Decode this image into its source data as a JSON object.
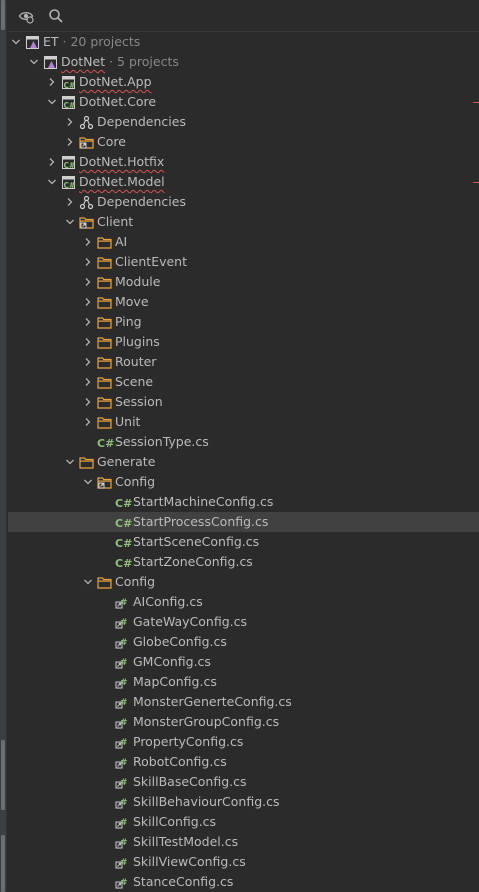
{
  "colors": {
    "background": "#2b2b2b",
    "selection": "#414141",
    "folder": "#e8a33d",
    "csharp": "#8fbf7a",
    "error_underline": "#d25252"
  },
  "toolbar": {
    "icons": [
      "eye-filter-icon",
      "search-icon"
    ]
  },
  "tree": [
    {
      "indent": 0,
      "expanded": true,
      "kind": "solution",
      "label": "ET",
      "meta": " · 20 projects"
    },
    {
      "indent": 1,
      "expanded": true,
      "kind": "solution",
      "label": "DotNet",
      "meta": " · 5 projects",
      "squiggle": true
    },
    {
      "indent": 2,
      "expanded": false,
      "kind": "project",
      "label": "DotNet.App",
      "squiggle": true
    },
    {
      "indent": 2,
      "expanded": true,
      "kind": "project",
      "label": "DotNet.Core"
    },
    {
      "indent": 3,
      "expanded": false,
      "kind": "deps",
      "label": "Dependencies"
    },
    {
      "indent": 3,
      "expanded": false,
      "kind": "linkfolder",
      "label": "Core"
    },
    {
      "indent": 2,
      "expanded": false,
      "kind": "project",
      "label": "DotNet.Hotfix",
      "squiggle": true
    },
    {
      "indent": 2,
      "expanded": true,
      "kind": "project",
      "label": "DotNet.Model",
      "squiggle": true
    },
    {
      "indent": 3,
      "expanded": false,
      "kind": "deps",
      "label": "Dependencies"
    },
    {
      "indent": 3,
      "expanded": true,
      "kind": "linkfolder",
      "label": "Client"
    },
    {
      "indent": 4,
      "expanded": false,
      "kind": "folder",
      "label": "AI"
    },
    {
      "indent": 4,
      "expanded": false,
      "kind": "folder",
      "label": "ClientEvent"
    },
    {
      "indent": 4,
      "expanded": false,
      "kind": "folder",
      "label": "Module"
    },
    {
      "indent": 4,
      "expanded": false,
      "kind": "folder",
      "label": "Move"
    },
    {
      "indent": 4,
      "expanded": false,
      "kind": "folder",
      "label": "Ping"
    },
    {
      "indent": 4,
      "expanded": false,
      "kind": "folder",
      "label": "Plugins"
    },
    {
      "indent": 4,
      "expanded": false,
      "kind": "folder",
      "label": "Router"
    },
    {
      "indent": 4,
      "expanded": false,
      "kind": "folder",
      "label": "Scene"
    },
    {
      "indent": 4,
      "expanded": false,
      "kind": "folder",
      "label": "Session"
    },
    {
      "indent": 4,
      "expanded": false,
      "kind": "folder",
      "label": "Unit"
    },
    {
      "indent": 4,
      "kind": "cs",
      "label": "SessionType.cs"
    },
    {
      "indent": 3,
      "expanded": true,
      "kind": "folder",
      "label": "Generate"
    },
    {
      "indent": 4,
      "expanded": true,
      "kind": "linkfolder",
      "label": "Config"
    },
    {
      "indent": 5,
      "kind": "cs",
      "label": "StartMachineConfig.cs"
    },
    {
      "indent": 5,
      "kind": "cs",
      "label": "StartProcessConfig.cs",
      "selected": true
    },
    {
      "indent": 5,
      "kind": "cs",
      "label": "StartSceneConfig.cs"
    },
    {
      "indent": 5,
      "kind": "cs",
      "label": "StartZoneConfig.cs"
    },
    {
      "indent": 4,
      "expanded": true,
      "kind": "folder",
      "label": "Config"
    },
    {
      "indent": 5,
      "kind": "cslink",
      "label": "AIConfig.cs"
    },
    {
      "indent": 5,
      "kind": "cslink",
      "label": "GateWayConfig.cs"
    },
    {
      "indent": 5,
      "kind": "cslink",
      "label": "GlobeConfig.cs"
    },
    {
      "indent": 5,
      "kind": "cslink",
      "label": "GMConfig.cs"
    },
    {
      "indent": 5,
      "kind": "cslink",
      "label": "MapConfig.cs"
    },
    {
      "indent": 5,
      "kind": "cslink",
      "label": "MonsterGenerteConfig.cs"
    },
    {
      "indent": 5,
      "kind": "cslink",
      "label": "MonsterGroupConfig.cs"
    },
    {
      "indent": 5,
      "kind": "cslink",
      "label": "PropertyConfig.cs"
    },
    {
      "indent": 5,
      "kind": "cslink",
      "label": "RobotConfig.cs"
    },
    {
      "indent": 5,
      "kind": "cslink",
      "label": "SkillBaseConfig.cs"
    },
    {
      "indent": 5,
      "kind": "cslink",
      "label": "SkillBehaviourConfig.cs"
    },
    {
      "indent": 5,
      "kind": "cslink",
      "label": "SkillConfig.cs"
    },
    {
      "indent": 5,
      "kind": "cslink",
      "label": "SkillTestModel.cs"
    },
    {
      "indent": 5,
      "kind": "cslink",
      "label": "SkillViewConfig.cs"
    },
    {
      "indent": 5,
      "kind": "cslink",
      "label": "StanceConfig.cs"
    }
  ]
}
